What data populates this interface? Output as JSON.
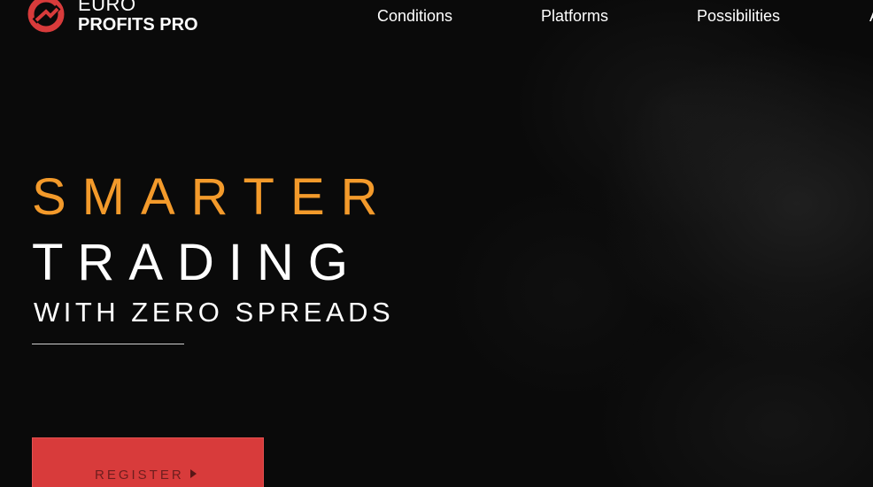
{
  "colors": {
    "background": "#0a0a0a",
    "accent_orange": "#f39a2b",
    "brand_red": "#d83b3b",
    "text_white": "#ffffff"
  },
  "header": {
    "logo": {
      "icon": "euro-profits-logo-icon",
      "line1": "EURO",
      "line2": "PROFITS PRO"
    },
    "nav": [
      {
        "label": "Conditions"
      },
      {
        "label": "Platforms"
      },
      {
        "label": "Possibilities"
      },
      {
        "label": "A"
      }
    ]
  },
  "hero": {
    "line1": "SMARTER",
    "line2": "TRADING",
    "line3": "WITH ZERO SPREADS",
    "cta": {
      "label": "REGISTER",
      "icon": "play-arrow-icon"
    }
  }
}
